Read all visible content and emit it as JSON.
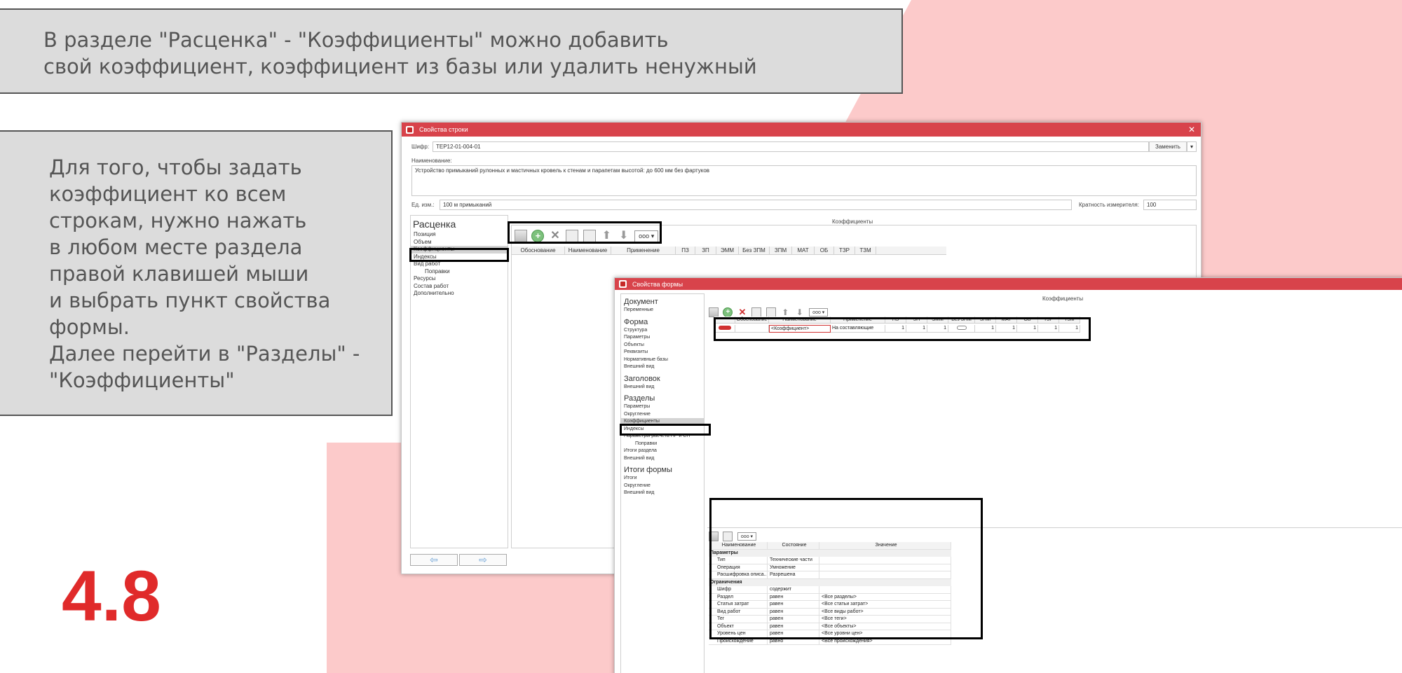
{
  "callouts": {
    "top_text": "В разделе \"Расценка\" - \"Коэффициенты\" можно добавить\nсвой коэффициент, коэффициент из базы или удалить ненужный",
    "left_text": "Для того, чтобы задать\nкоэффициент ко всем\nстрокам, нужно нажать\nв любом месте раздела\nправой клавишей мыши\nи выбрать пункт свойства\nформы.\nДалее перейти в \"Разделы\" -\n\"Коэффициенты\""
  },
  "slide_number": "4.8",
  "colors": {
    "accent": "#d8434b",
    "number": "#e02a2a",
    "background_pink": "#fccaca"
  },
  "win1": {
    "title": "Свойства строки",
    "cipher_label": "Шифр:",
    "cipher_value": "ТЕР12-01-004-01",
    "replace_button": "Заменить",
    "name_label": "Наименование:",
    "name_value": "Устройство примыканий рулонных и мастичных кровель к стенам и парапетам высотой: до 600 мм без фартуков",
    "unit_label": "Ед. изм.:",
    "unit_value": "100 м примыканий",
    "multiplicity_label": "Кратность измерителя:",
    "multiplicity_value": "100",
    "tree_title": "Расценка",
    "tree_items": [
      "Позиция",
      "Объем",
      "Коэффициенты",
      "Индексы",
      "Вид работ",
      "Поправки",
      "Ресурсы",
      "Состав работ",
      "Дополнительно"
    ],
    "section_title": "Коэффициенты",
    "more_label": "ooo",
    "columns": [
      "Обоснование",
      "Наименование",
      "Применение",
      "ПЗ",
      "ЗП",
      "ЭММ",
      "Без ЗПМ",
      "ЗПМ",
      "МАТ",
      "ОБ",
      "ТЗР",
      "ТЗМ"
    ],
    "nav_back": "⇦",
    "nav_forward": "⇨"
  },
  "win2": {
    "title": "Свойства формы",
    "section_title": "Коэффициенты",
    "tree": [
      {
        "group": "Документ",
        "items": [
          "Переменные"
        ]
      },
      {
        "group": "Форма",
        "items": [
          "Структура",
          "Параметры",
          "Объекты",
          "Реквизиты",
          "Нормативные базы",
          "Внешний вид"
        ]
      },
      {
        "group": "Заголовок",
        "items": [
          "Внешний вид"
        ]
      },
      {
        "group": "Разделы",
        "items": [
          "Параметры",
          "Округление",
          "Коэффициенты",
          "Индексы",
          "Параметры расчета НР и СП",
          "Поправки",
          "Итоги раздела",
          "Внешний вид"
        ]
      },
      {
        "group": "Итоги формы",
        "items": [
          "Итоги",
          "Округление",
          "Внешний вид"
        ]
      }
    ],
    "more_label": "ooo",
    "columns": [
      "",
      "Обоснование",
      "Наименование",
      "Применение",
      "ПЗ",
      "ЗП",
      "ЭММ",
      "Без ЗПМ",
      "ЗПМ",
      "МАТ",
      "ОБ",
      "ТЗР",
      "ТЗМ"
    ],
    "row": {
      "name": "<Коэффициент>",
      "apply": "На составляющие",
      "pz": "1",
      "zp": "1",
      "emm": "1",
      "zpm": "1",
      "mat": "1",
      "ob": "1",
      "tzr": "1",
      "tzm": "1"
    },
    "props_columns": [
      "Наименование",
      "Состояние",
      "Значение"
    ],
    "props_groups": [
      {
        "title": "Параметры",
        "rows": [
          [
            "Тип",
            "Технические части",
            ""
          ],
          [
            "Операция",
            "Умножение",
            ""
          ],
          [
            "Расшифровка описа...",
            "Разрешена",
            ""
          ]
        ]
      },
      {
        "title": "Ограничения",
        "rows": [
          [
            "Шифр",
            "содержит",
            ""
          ],
          [
            "Раздел",
            "равен",
            "<Все разделы>"
          ],
          [
            "Статья затрат",
            "равен",
            "<Все статьи затрат>"
          ],
          [
            "Вид работ",
            "равен",
            "<Все виды работ>"
          ],
          [
            "Тег",
            "равен",
            "<Все теги>"
          ],
          [
            "Объект",
            "равен",
            "<Все объекты>"
          ],
          [
            "Уровень цен",
            "равен",
            "<Все уровни цен>"
          ],
          [
            "Происхождение",
            "равно",
            "<Все происхождения>"
          ]
        ]
      }
    ]
  }
}
